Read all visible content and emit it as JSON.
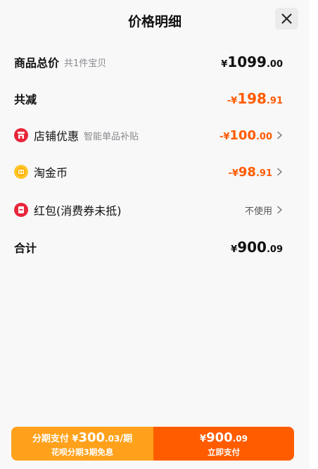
{
  "header": {
    "title": "价格明细"
  },
  "rows": {
    "goods_total": {
      "label": "商品总价",
      "sub": "共1件宝贝",
      "symbol": "¥",
      "int": "1099",
      "dec": ".00"
    },
    "discount_total": {
      "label": "共减",
      "symbol": "-¥",
      "int": "198",
      "dec": ".91"
    },
    "shop_discount": {
      "label": "店铺优惠",
      "sub": "智能单品补贴",
      "symbol": "-¥",
      "int": "100",
      "dec": ".00"
    },
    "taojinbi": {
      "label": "淘金币",
      "symbol": "-¥",
      "int": "98",
      "dec": ".91"
    },
    "red_packet": {
      "label": "红包(消费券未抵)",
      "value": "不使用"
    },
    "total": {
      "label": "合计",
      "symbol": "¥",
      "int": "900",
      "dec": ".09"
    }
  },
  "bottom": {
    "installment": {
      "prefix": "分期支付 ¥",
      "int": "300",
      "dec": ".03",
      "suffix": "/期",
      "line2": "花呗分期3期免息"
    },
    "pay": {
      "symbol": "¥",
      "int": "900",
      "dec": ".09",
      "line2": "立即支付"
    }
  },
  "colors": {
    "accent": "#ff5b00",
    "installment_bg": "#ffa11a",
    "pay_bg": "#ff5c00"
  },
  "icons": [
    "close-icon",
    "shop-icon",
    "coin-icon",
    "red-packet-icon",
    "chevron-right-icon"
  ]
}
